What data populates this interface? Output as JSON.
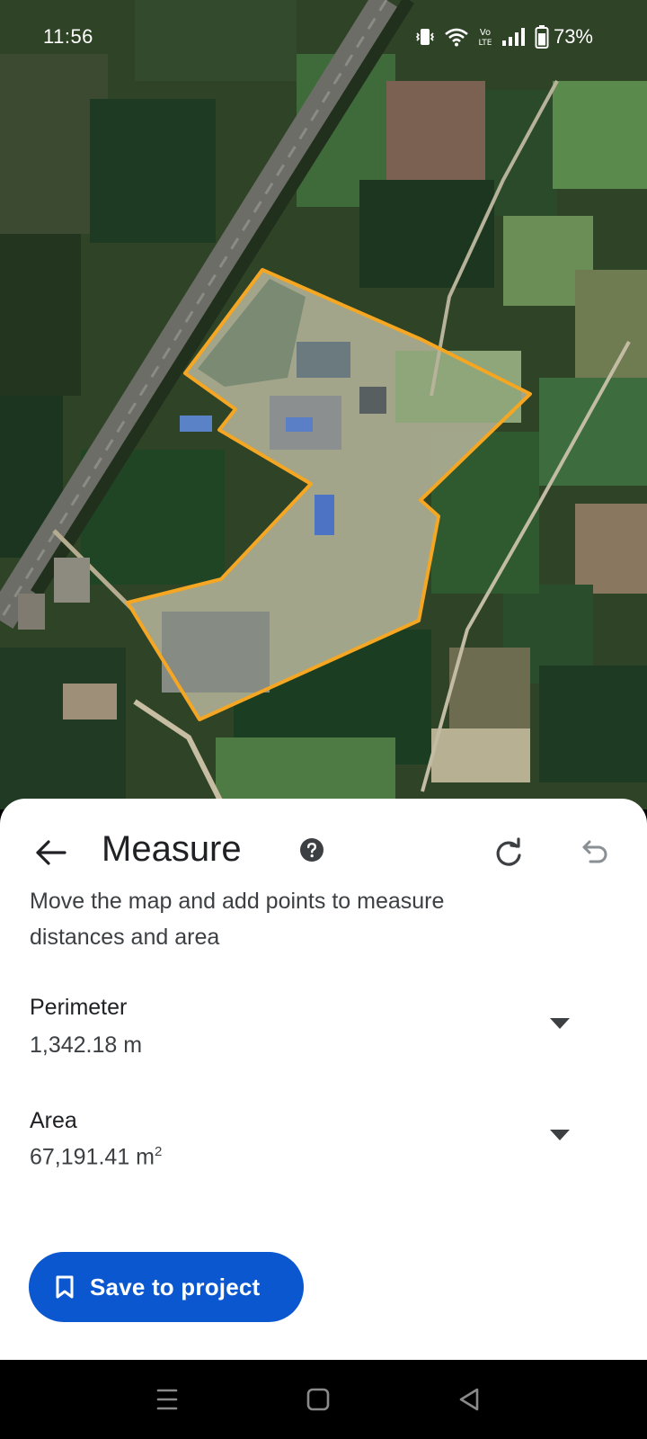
{
  "status_bar": {
    "time": "11:56",
    "battery_percent": "73%",
    "icons": [
      "vibrate-icon",
      "wifi-icon",
      "volte-icon",
      "signal-icon",
      "battery-icon"
    ]
  },
  "map": {
    "type": "satellite",
    "outline_color": "#f5a623"
  },
  "measure_sheet": {
    "title": "Measure",
    "instructions": "Move the map and add points to measure distances and area",
    "perimeter": {
      "label": "Perimeter",
      "value": "1,342.18 m"
    },
    "area": {
      "label": "Area",
      "value": "67,191.41 m",
      "unit_superscript": "2"
    },
    "save_button": "Save to project",
    "accent_color": "#0b57d0"
  },
  "navigation_bar": {
    "buttons": [
      "recents-icon",
      "home-icon",
      "back-icon"
    ]
  }
}
